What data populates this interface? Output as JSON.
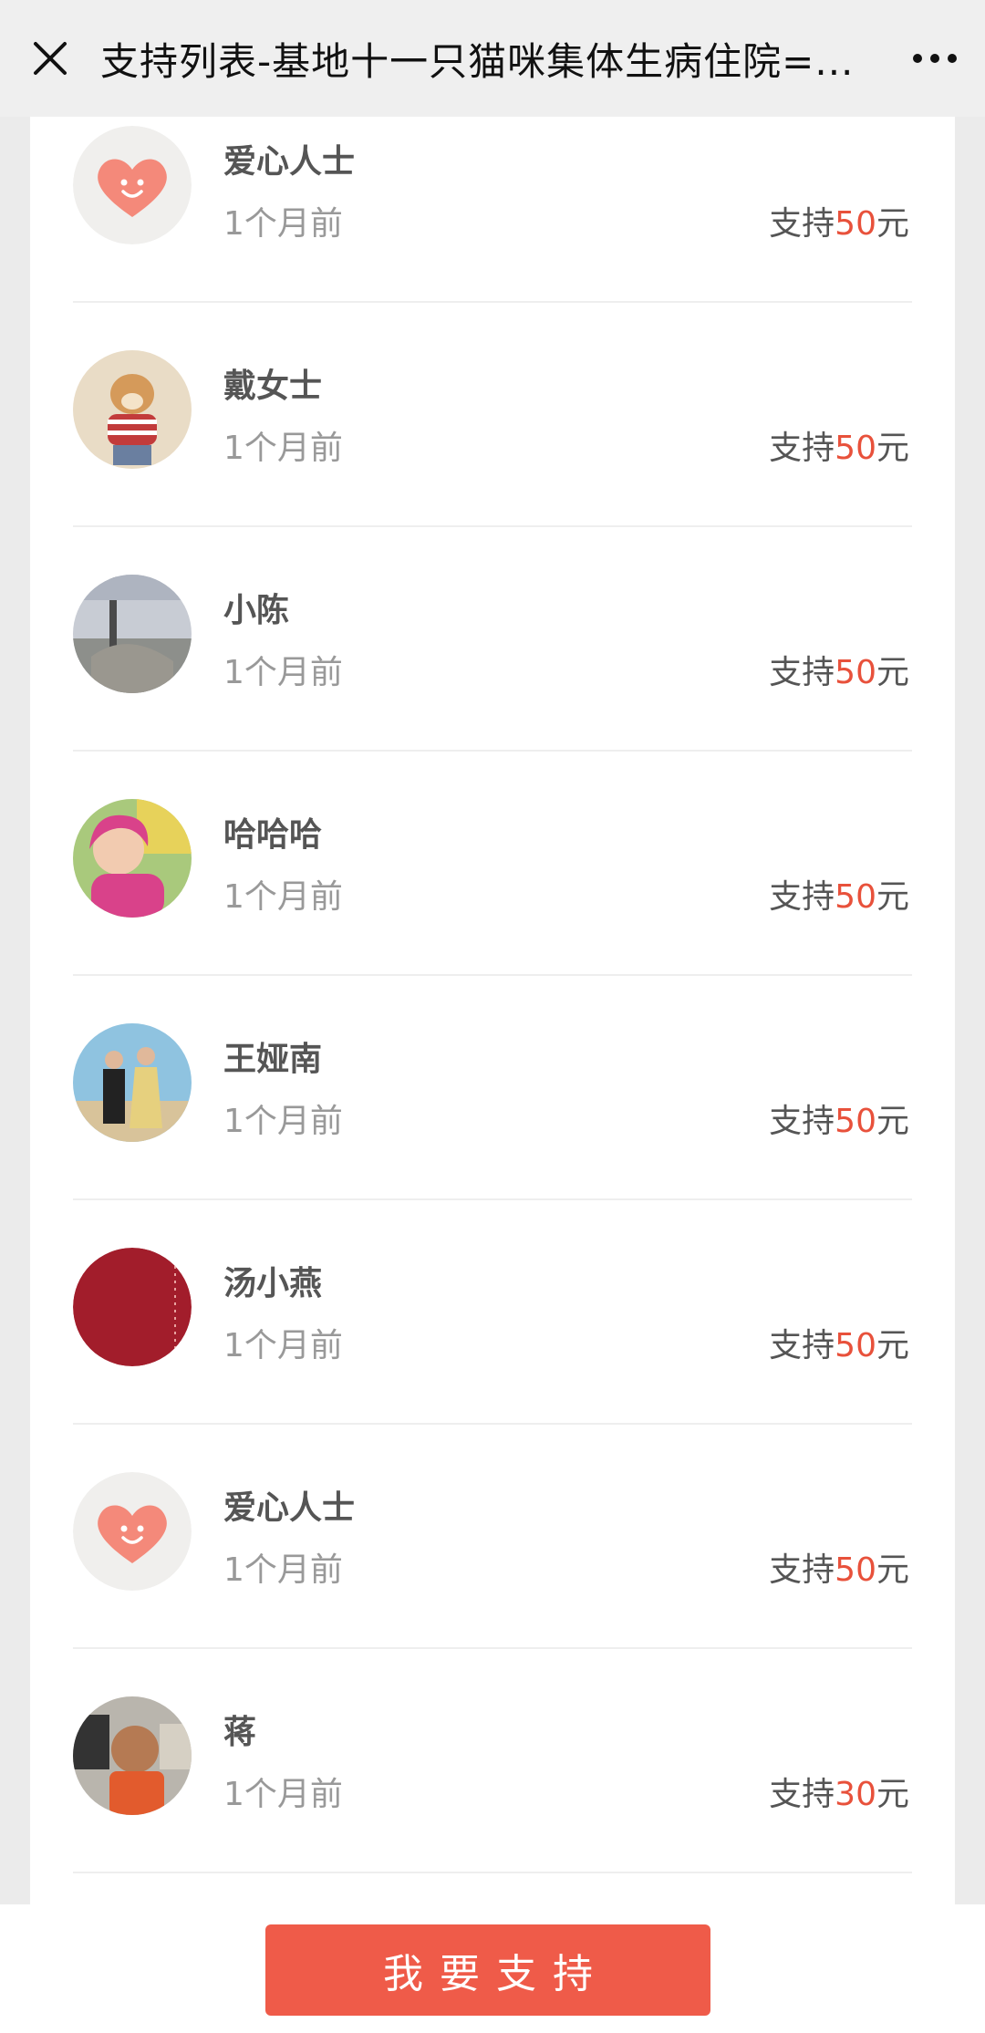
{
  "header": {
    "title": "支持列表-基地十一只猫咪集体生病住院=..."
  },
  "supporters": [
    {
      "name": "爱心人士",
      "time": "1个月前",
      "prefix": "支持",
      "amount": "50",
      "unit": "元",
      "avatar": "heart-default"
    },
    {
      "name": "戴女士",
      "time": "1个月前",
      "prefix": "支持",
      "amount": "50",
      "unit": "元",
      "avatar": "dog-photo"
    },
    {
      "name": "小陈",
      "time": "1个月前",
      "prefix": "支持",
      "amount": "50",
      "unit": "元",
      "avatar": "landscape-photo"
    },
    {
      "name": "哈哈哈",
      "time": "1个月前",
      "prefix": "支持",
      "amount": "50",
      "unit": "元",
      "avatar": "baby-photo"
    },
    {
      "name": "王娅南",
      "time": "1个月前",
      "prefix": "支持",
      "amount": "50",
      "unit": "元",
      "avatar": "couple-photo"
    },
    {
      "name": "汤小燕",
      "time": "1个月前",
      "prefix": "支持",
      "amount": "50",
      "unit": "元",
      "avatar": "red-circle"
    },
    {
      "name": "爱心人士",
      "time": "1个月前",
      "prefix": "支持",
      "amount": "50",
      "unit": "元",
      "avatar": "heart-default"
    },
    {
      "name": "蒋",
      "time": "1个月前",
      "prefix": "支持",
      "amount": "30",
      "unit": "元",
      "avatar": "child-photo"
    }
  ],
  "footer": {
    "support_button": "我要支持"
  },
  "colors": {
    "accent": "#ef5b49",
    "amount": "#e8513b"
  }
}
